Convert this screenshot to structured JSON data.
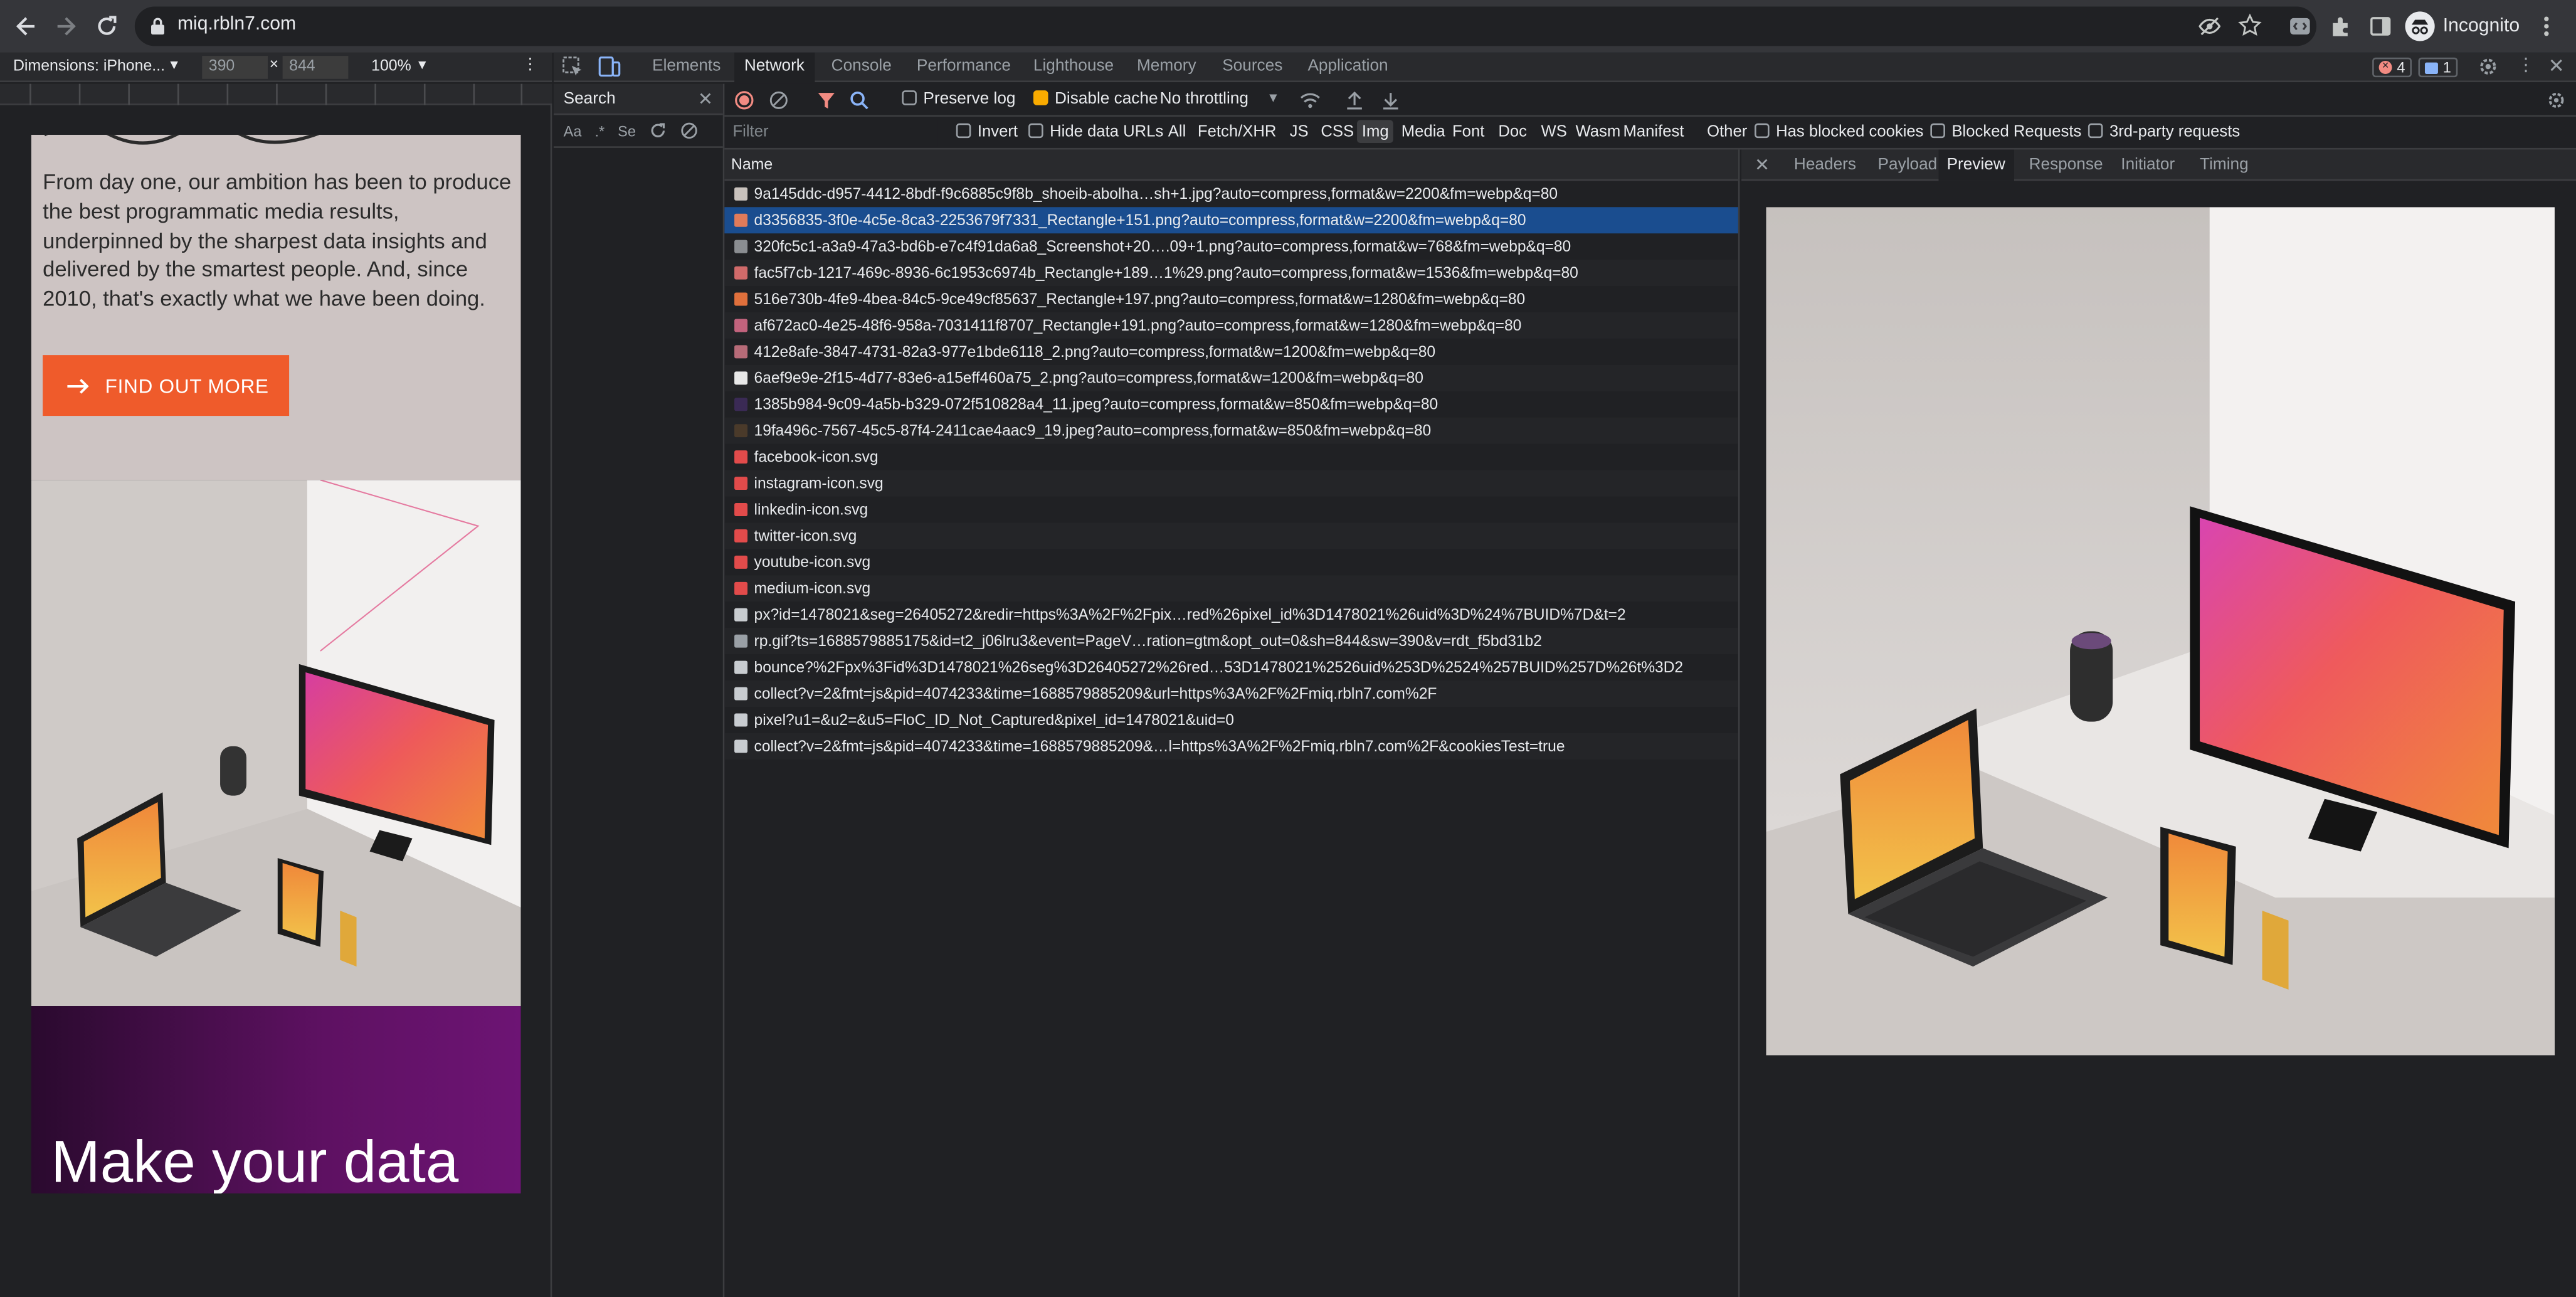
{
  "browser": {
    "url": "miq.rbln7.com",
    "profile_label": "Incognito"
  },
  "device_toolbar": {
    "device": "Dimensions: iPhone...",
    "width": "390",
    "height": "844",
    "zoom": "100%"
  },
  "site": {
    "hero_body": "From day one, our ambition has been to produce the best programmatic media results, underpinned by the sharpest data insights and delivered by the smartest people. And, since 2010, that's exactly what we have been doing.",
    "cta_label": "FIND OUT MORE",
    "cta_color": "#ef5b2b",
    "bottom_heading": "Make your data"
  },
  "devtools": {
    "tabs": [
      "Elements",
      "Network",
      "Console",
      "Performance",
      "Lighthouse",
      "Memory",
      "Sources",
      "Application"
    ],
    "active_tab": "Network",
    "error_count": "4",
    "message_count": "1",
    "search_panel": {
      "title": "Search",
      "opt_case": "Aa",
      "opt_regex": ".*",
      "opt_se": "Se"
    },
    "network": {
      "preserve_log": "Preserve log",
      "disable_cache": "Disable cache",
      "throttling": "No throttling",
      "filter_placeholder": "Filter",
      "invert": "Invert",
      "hide_data_urls": "Hide data URLs",
      "type_filters": [
        "All",
        "Fetch/XHR",
        "JS",
        "CSS",
        "Img",
        "Media",
        "Font",
        "Doc",
        "WS",
        "Wasm",
        "Manifest",
        "Other"
      ],
      "active_type": "Img",
      "has_blocked_cookies": "Has blocked cookies",
      "blocked_requests": "Blocked Requests",
      "third_party": "3rd-party requests",
      "column_name": "Name",
      "requests": [
        {
          "name": "9a145ddc-d957-4412-8bdf-f9c6885c9f8b_shoeib-abolha…sh+1.jpg?auto=compress,format&w=2200&fm=webp&q=80",
          "icon": "image-icon",
          "color": "#c9c2bd"
        },
        {
          "name": "d3356835-3f0e-4c5e-8ca3-2253679f7331_Rectangle+151.png?auto=compress,format&w=2200&fm=webp&q=80",
          "icon": "image-icon",
          "color": "#e07b5a"
        },
        {
          "name": "320fc5c1-a3a9-47a3-bd6b-e7c4f91da6a8_Screenshot+20….09+1.png?auto=compress,format&w=768&fm=webp&q=80",
          "icon": "image-icon",
          "color": "#8a8d91"
        },
        {
          "name": "fac5f7cb-1217-469c-8936-6c1953c6974b_Rectangle+189…1%29.png?auto=compress,format&w=1536&fm=webp&q=80",
          "icon": "image-icon",
          "color": "#d06a6a"
        },
        {
          "name": "516e730b-4fe9-4bea-84c5-9ce49cf85637_Rectangle+197.png?auto=compress,format&w=1280&fm=webp&q=80",
          "icon": "image-icon",
          "color": "#e0703c"
        },
        {
          "name": "af672ac0-4e25-48f6-958a-7031411f8707_Rectangle+191.png?auto=compress,format&w=1280&fm=webp&q=80",
          "icon": "image-icon",
          "color": "#c2637d"
        },
        {
          "name": "412e8afe-3847-4731-82a3-977e1bde6118_2.png?auto=compress,format&w=1200&fm=webp&q=80",
          "icon": "image-icon",
          "color": "#b76b78"
        },
        {
          "name": "6aef9e9e-2f15-4d77-83e6-a15eff460a75_2.png?auto=compress,format&w=1200&fm=webp&q=80",
          "icon": "image-icon",
          "color": "#e8e8e8"
        },
        {
          "name": "1385b984-9c09-4a5b-b329-072f510828a4_11.jpeg?auto=compress,format&w=850&fm=webp&q=80",
          "icon": "image-icon",
          "color": "#3a2a55"
        },
        {
          "name": "19fa496c-7567-45c5-87f4-2411cae4aac9_19.jpeg?auto=compress,format&w=850&fm=webp&q=80",
          "icon": "image-icon",
          "color": "#4a3a2a"
        },
        {
          "name": "facebook-icon.svg",
          "icon": "svg-icon",
          "color": "#e24b4b"
        },
        {
          "name": "instagram-icon.svg",
          "icon": "svg-icon",
          "color": "#e24b4b"
        },
        {
          "name": "linkedin-icon.svg",
          "icon": "svg-icon",
          "color": "#e24b4b"
        },
        {
          "name": "twitter-icon.svg",
          "icon": "svg-icon",
          "color": "#e24b4b"
        },
        {
          "name": "youtube-icon.svg",
          "icon": "svg-icon",
          "color": "#e24b4b"
        },
        {
          "name": "medium-icon.svg",
          "icon": "svg-icon",
          "color": "#e24b4b"
        },
        {
          "name": "px?id=1478021&seg=26405272&redir=https%3A%2F%2Fpix…red%26pixel_id%3D1478021%26uid%3D%24%7BUID%7D&t=2",
          "icon": "document-icon",
          "color": "#c8ccd0"
        },
        {
          "name": "rp.gif?ts=1688579885175&id=t2_j06lru3&event=PageV…ration=gtm&opt_out=0&sh=844&sw=390&v=rdt_f5bd31b2",
          "icon": "pixel-icon",
          "color": "#9aa0a6"
        },
        {
          "name": "bounce?%2Fpx%3Fid%3D1478021%26seg%3D26405272%26red…53D1478021%2526uid%253D%2524%257BUID%257D%26t%3D2",
          "icon": "document-icon",
          "color": "#c8ccd0"
        },
        {
          "name": "collect?v=2&fmt=js&pid=4074233&time=1688579885209&url=https%3A%2F%2Fmiq.rbln7.com%2F",
          "icon": "document-icon",
          "color": "#c8ccd0"
        },
        {
          "name": "pixel?u1=&u2=&u5=FloC_ID_Not_Captured&pixel_id=1478021&uid=0",
          "icon": "document-icon",
          "color": "#c8ccd0"
        },
        {
          "name": "collect?v=2&fmt=js&pid=4074233&time=1688579885209&…l=https%3A%2F%2Fmiq.rbln7.com%2F&cookiesTest=true",
          "icon": "document-icon",
          "color": "#c8ccd0"
        }
      ],
      "selected_index": 1,
      "detail_tabs": [
        "Headers",
        "Payload",
        "Preview",
        "Response",
        "Initiator",
        "Timing"
      ],
      "active_detail_tab": "Preview"
    }
  },
  "colors": {
    "selection": "#1a4d8f",
    "record": "#f28b82",
    "accent": "#8ab4f8"
  }
}
